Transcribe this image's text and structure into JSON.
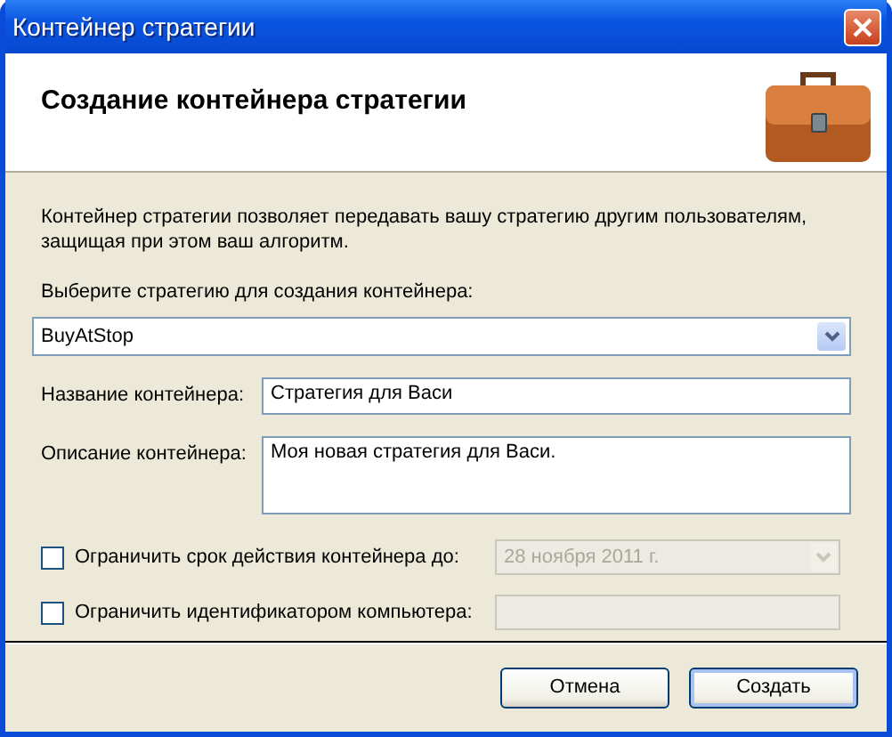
{
  "window": {
    "title": "Контейнер стратегии"
  },
  "header": {
    "title": "Создание контейнера стратегии"
  },
  "intro": "Контейнер стратегии позволяет передавать вашу стратегию другим пользователям, защищая при этом ваш алгоритм.",
  "strategy": {
    "label": "Выберите стратегию для создания контейнера:",
    "value": "BuyAtStop"
  },
  "name_field": {
    "label": "Название контейнера:",
    "value": "Стратегия для Васи"
  },
  "description_field": {
    "label": "Описание контейнера:",
    "value": "Моя новая стратегия для Васи."
  },
  "restrictions": [
    {
      "kind": "date",
      "label": "Ограничить срок действия контейнера до:",
      "checked": false,
      "disabled": true,
      "value": "28  ноября   2011 г."
    },
    {
      "kind": "text",
      "label": "Ограничить идентификатором компьютера:",
      "checked": false,
      "disabled": true
    }
  ],
  "buttons": [
    {
      "label": "Отмена",
      "default": false
    },
    {
      "label": "Создать",
      "default": true
    }
  ]
}
